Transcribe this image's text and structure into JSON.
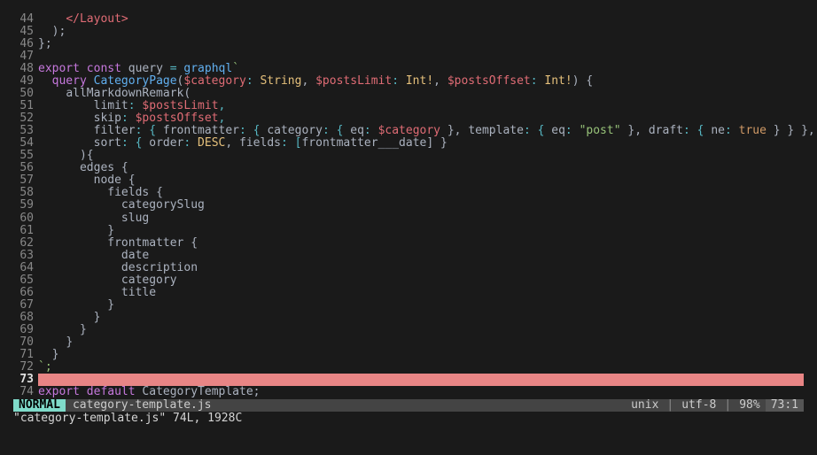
{
  "lines": {
    "l44": {
      "num": "44",
      "indent": "    ",
      "jsx": "</Layout>"
    },
    "l45": {
      "num": "45",
      "indent": "  ",
      "text": ");"
    },
    "l46": {
      "num": "46",
      "text": "};"
    },
    "l47": {
      "num": "47",
      "text": ""
    },
    "l48": {
      "num": "48",
      "kw1": "export",
      "kw2": "const",
      "name": "query",
      "eq": " = ",
      "fn": "graphql",
      "tick": "`"
    },
    "l49": {
      "num": "49",
      "indent": "  ",
      "kw": "query",
      "name": "CategoryPage",
      "p1": "(",
      "v1": "$category",
      "c1": ": ",
      "t1": "String",
      "cm1": ", ",
      "v2": "$postsLimit",
      "c2": ": ",
      "t2": "Int!",
      "cm2": ", ",
      "v3": "$postsOffset",
      "c3": ": ",
      "t3": "Int!",
      "p2": ")",
      "brace": " {"
    },
    "l50": {
      "num": "50",
      "indent": "    ",
      "text": "allMarkdownRemark("
    },
    "l51": {
      "num": "51",
      "indent": "        ",
      "key": "limit",
      "c": ": ",
      "val": "$postsLimit",
      "cm": ","
    },
    "l52": {
      "num": "52",
      "indent": "        ",
      "key": "skip",
      "c": ": ",
      "val": "$postsOffset",
      "cm": ","
    },
    "l53": {
      "num": "53",
      "indent": "        ",
      "k1": "filter",
      "c1": ": { ",
      "k2": "frontmatter",
      "c2": ": { ",
      "k3": "category",
      "c3": ": { ",
      "k4": "eq",
      "c4": ": ",
      "v1": "$category",
      "b1": " }, ",
      "k5": "template",
      "c5": ": { ",
      "k6": "eq",
      "c6": ": ",
      "s1": "\"post\"",
      "b2": " }, ",
      "k7": "draft",
      "c7": ": { ",
      "k8": "ne",
      "c8": ": ",
      "bl": "true",
      "b3": " } } },"
    },
    "l54": {
      "num": "54",
      "indent": "        ",
      "k1": "sort",
      "c1": ": { ",
      "k2": "order",
      "c2": ": ",
      "v1": "DESC",
      "cm": ", ",
      "k3": "fields",
      "c3": ": [",
      "v2": "frontmatter___date",
      "b": "] }"
    },
    "l55": {
      "num": "55",
      "indent": "      ",
      "text": "){"
    },
    "l56": {
      "num": "56",
      "indent": "      ",
      "text": "edges {"
    },
    "l57": {
      "num": "57",
      "indent": "        ",
      "text": "node {"
    },
    "l58": {
      "num": "58",
      "indent": "          ",
      "text": "fields {"
    },
    "l59": {
      "num": "59",
      "indent": "            ",
      "text": "categorySlug"
    },
    "l60": {
      "num": "60",
      "indent": "            ",
      "text": "slug"
    },
    "l61": {
      "num": "61",
      "indent": "          ",
      "text": "}"
    },
    "l62": {
      "num": "62",
      "indent": "          ",
      "text": "frontmatter {"
    },
    "l63": {
      "num": "63",
      "indent": "            ",
      "text": "date"
    },
    "l64": {
      "num": "64",
      "indent": "            ",
      "text": "description"
    },
    "l65": {
      "num": "65",
      "indent": "            ",
      "text": "category"
    },
    "l66": {
      "num": "66",
      "indent": "            ",
      "text": "title"
    },
    "l67": {
      "num": "67",
      "indent": "          ",
      "text": "}"
    },
    "l68": {
      "num": "68",
      "indent": "        ",
      "text": "}"
    },
    "l69": {
      "num": "69",
      "indent": "      ",
      "text": "}"
    },
    "l70": {
      "num": "70",
      "indent": "    ",
      "text": "}"
    },
    "l71": {
      "num": "71",
      "indent": "  ",
      "text": "}"
    },
    "l72": {
      "num": "72",
      "text": "`;"
    },
    "l73": {
      "num": "73",
      "text": " "
    },
    "l74": {
      "num": "74",
      "kw1": "export",
      "kw2": "default",
      "name": "CategoryTemplate",
      "semi": ";"
    }
  },
  "status": {
    "mode": "NORMAL",
    "filename": "category-template.js",
    "format": "unix",
    "encoding": "utf-8",
    "percent": "98%",
    "position": "73:1"
  },
  "message": "\"category-template.js\" 74L, 1928C"
}
